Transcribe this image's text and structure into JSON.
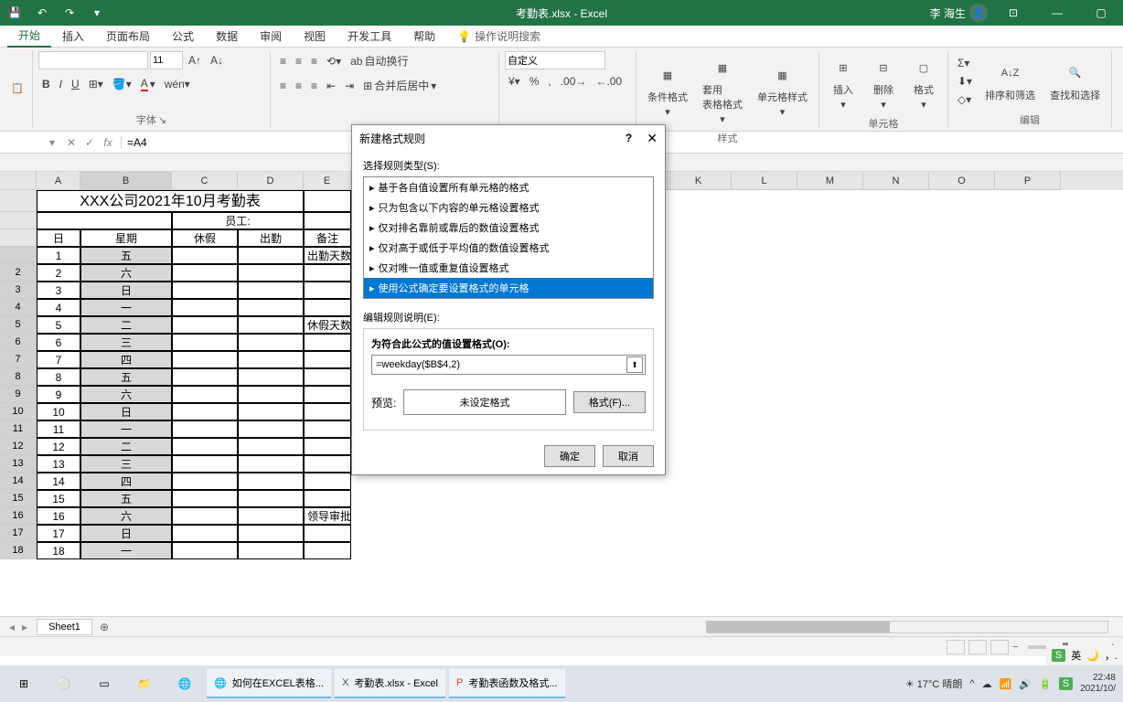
{
  "title": "考勤表.xlsx  -  Excel",
  "user": "李 海生",
  "ribbon_tabs": [
    "开始",
    "插入",
    "页面布局",
    "公式",
    "数据",
    "审阅",
    "视图",
    "开发工具",
    "帮助"
  ],
  "tell_me": "操作说明搜索",
  "font": {
    "size": "11"
  },
  "number_format": "自定义",
  "ribbon_groups": {
    "font": "字体",
    "alignment": {
      "wrap": "自动换行",
      "merge": "合并后居中"
    },
    "styles": {
      "label": "样式",
      "cond": "条件格式",
      "table": "套用\n表格格式",
      "cell": "单元格样式"
    },
    "cells": {
      "label": "单元格",
      "insert": "插入",
      "delete": "删除",
      "format": "格式"
    },
    "editing": {
      "label": "编辑",
      "sort": "排序和筛选",
      "find": "查找和选择"
    }
  },
  "name_box": "",
  "formula": "=A4",
  "dialog": {
    "title": "新建格式规则",
    "select_label": "选择规则类型(S):",
    "rules": [
      "基于各自值设置所有单元格的格式",
      "只为包含以下内容的单元格设置格式",
      "仅对排名靠前或靠后的数值设置格式",
      "仅对高于或低于平均值的数值设置格式",
      "仅对唯一值或重复值设置格式",
      "使用公式确定要设置格式的单元格"
    ],
    "edit_label": "编辑规则说明(E):",
    "formula_label": "为符合此公式的值设置格式(O):",
    "formula_value": "=weekday($B$4,2)",
    "preview_label": "预览:",
    "preview_text": "未设定格式",
    "format_btn": "格式(F)...",
    "ok": "确定",
    "cancel": "取消"
  },
  "sheet": {
    "title": "XXX公司2021年10月考勤表",
    "employee_label": "员工:",
    "headers": {
      "day": "日",
      "weekday": "星期",
      "vacation": "休假",
      "attend": "出勤",
      "note": "备注"
    },
    "side_labels": {
      "attend_days": "出勤天数",
      "vacation_days": "休假天数",
      "leader": "领导审批:"
    },
    "rows": [
      {
        "day": "1",
        "wd": "五"
      },
      {
        "day": "2",
        "wd": "六"
      },
      {
        "day": "3",
        "wd": "日"
      },
      {
        "day": "4",
        "wd": "一"
      },
      {
        "day": "5",
        "wd": "二"
      },
      {
        "day": "6",
        "wd": "三"
      },
      {
        "day": "7",
        "wd": "四"
      },
      {
        "day": "8",
        "wd": "五"
      },
      {
        "day": "9",
        "wd": "六"
      },
      {
        "day": "10",
        "wd": "日"
      },
      {
        "day": "11",
        "wd": "一"
      },
      {
        "day": "12",
        "wd": "二"
      },
      {
        "day": "13",
        "wd": "三"
      },
      {
        "day": "14",
        "wd": "四"
      },
      {
        "day": "15",
        "wd": "五"
      },
      {
        "day": "16",
        "wd": "六"
      },
      {
        "day": "17",
        "wd": "日"
      },
      {
        "day": "18",
        "wd": "一"
      }
    ],
    "col_letters": [
      "A",
      "B",
      "C",
      "D",
      "E",
      "",
      "",
      "",
      "",
      "K",
      "L",
      "M",
      "N",
      "O",
      "P"
    ]
  },
  "sheet_tab": "Sheet1",
  "taskbar": {
    "items": [
      "如何在EXCEL表格...",
      "考勤表.xlsx - Excel",
      "考勤表函数及格式..."
    ],
    "weather": "17°C 晴朗",
    "time": "22:48",
    "date": "2021/10/"
  },
  "ime": "英"
}
